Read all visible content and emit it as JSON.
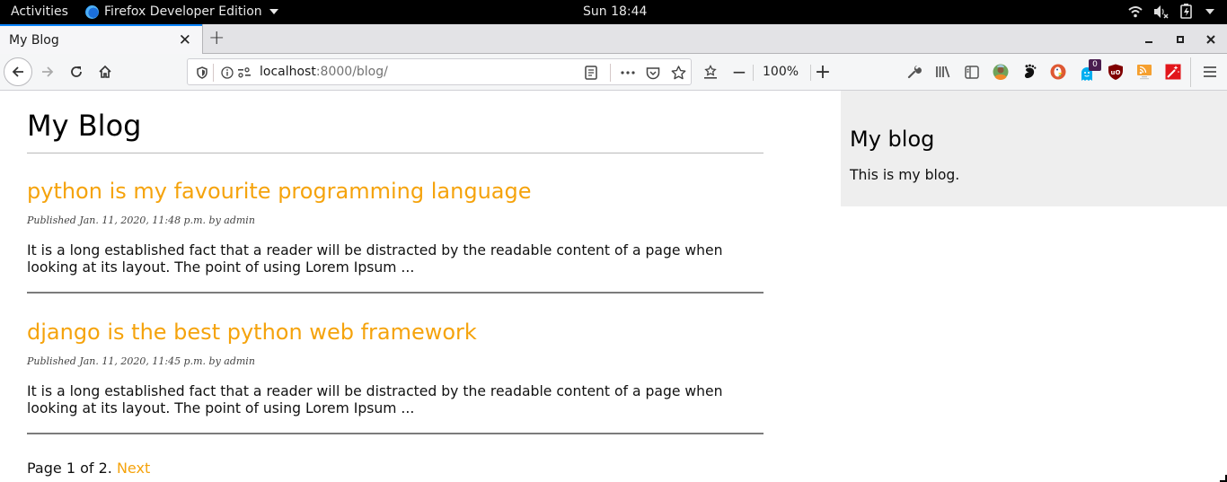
{
  "system_bar": {
    "activities": "Activities",
    "app_name": "Firefox Developer Edition",
    "clock": "Sun 18:44",
    "tray_icons": [
      "wifi-icon",
      "volume-muted-icon",
      "battery-icon",
      "system-menu-caret-icon"
    ]
  },
  "browser": {
    "tab": {
      "title": "My Blog",
      "close_glyph": "✕"
    },
    "new_tab_glyph": "+",
    "window_controls": {
      "minimize": "–",
      "maximize": "▫",
      "close": "✕"
    },
    "url": {
      "host": "localhost",
      "rest": ":8000/blog/"
    },
    "zoom_level": "100%",
    "zoom_out_glyph": "−",
    "zoom_in_glyph": "+",
    "extensions": [
      "avatar-extension",
      "gnome-extension",
      "duckduckgo-extension",
      "ghostery-extension",
      "ublock-origin-extension",
      "rss-extension",
      "magic-wand-extension"
    ],
    "ghostery_badge": "0",
    "accent_color": "#0a84ff"
  },
  "page": {
    "title": "My Blog",
    "link_color": "#f5a30c",
    "posts": [
      {
        "title": "python is my favourite programming language",
        "meta": "Published Jan. 11, 2020, 11:48 p.m. by admin",
        "excerpt": "It is a long established fact that a reader will be distracted by the readable content of a page when looking at its layout. The point of using Lorem Ipsum ..."
      },
      {
        "title": "django is the best python web framework",
        "meta": "Published Jan. 11, 2020, 11:45 p.m. by admin",
        "excerpt": "It is a long established fact that a reader will be distracted by the readable content of a page when looking at its layout. The point of using Lorem Ipsum ..."
      }
    ],
    "pagination": {
      "status": "Page 1 of 2.",
      "next_label": "Next"
    },
    "sidebar": {
      "title": "My blog",
      "text": "This is my blog."
    }
  }
}
